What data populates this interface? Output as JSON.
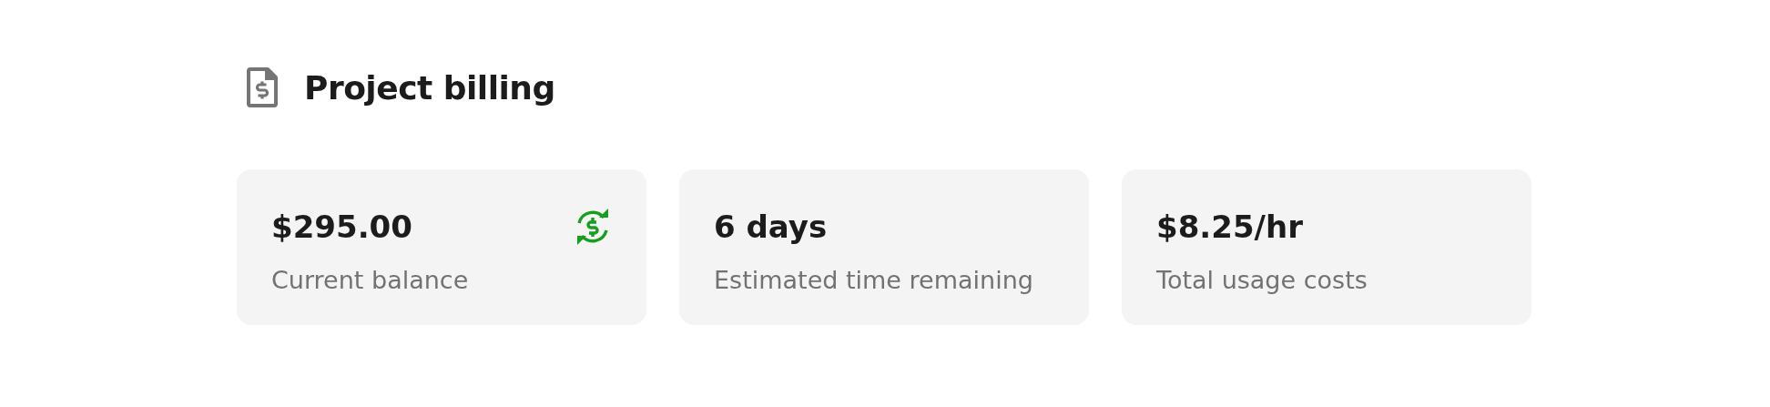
{
  "header": {
    "title": "Project billing"
  },
  "cards": [
    {
      "value": "$295.00",
      "label": "Current balance",
      "kind": "balance"
    },
    {
      "value": "6 days",
      "label": "Estimated time remaining",
      "kind": "plain"
    },
    {
      "value": "$8.25/hr",
      "label": "Total usage costs",
      "kind": "plain"
    }
  ]
}
